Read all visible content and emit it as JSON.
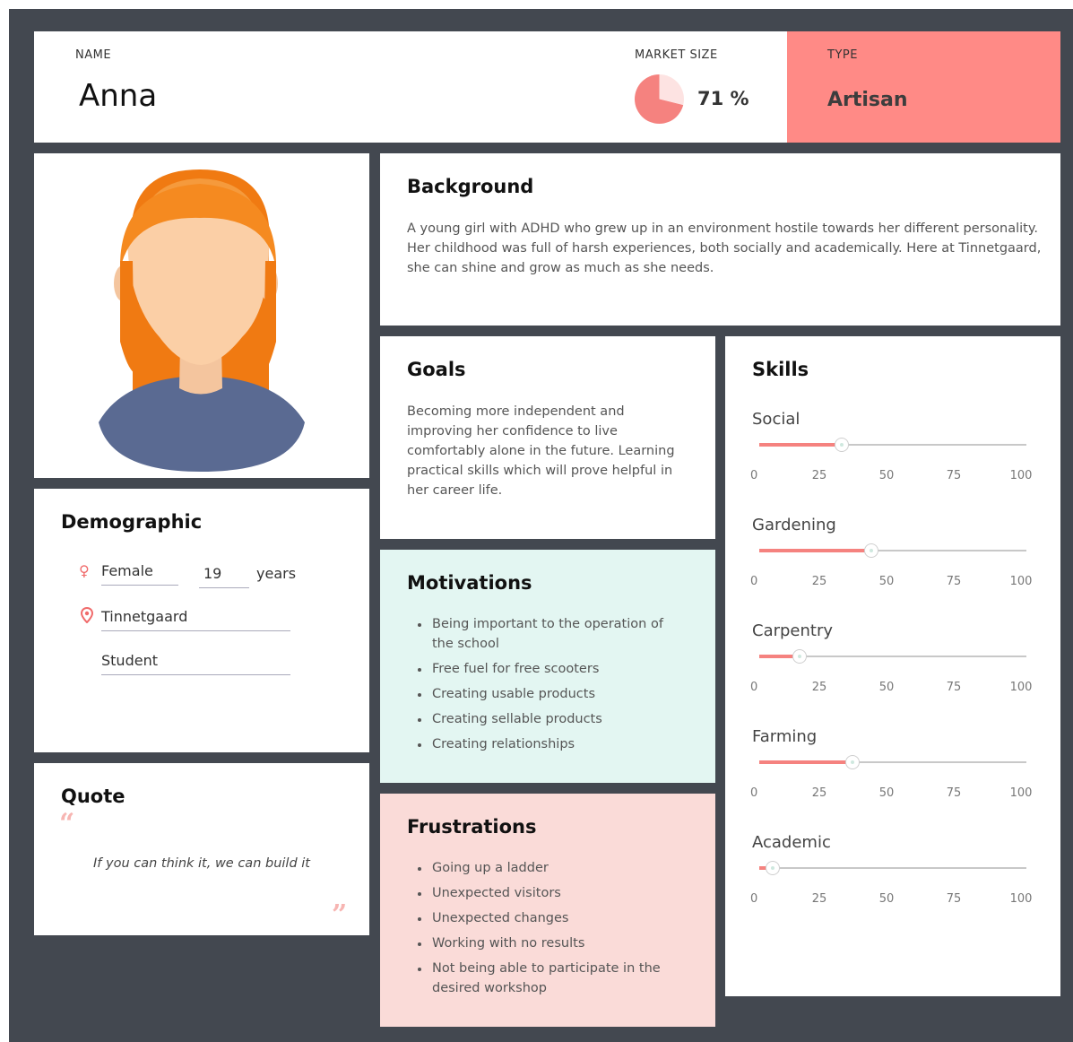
{
  "header": {
    "name_label": "NAME",
    "name": "Anna",
    "market_label": "MARKET SIZE",
    "market_value": "71 %",
    "market_fraction": 0.71,
    "type_label": "TYPE",
    "type": "Artisan"
  },
  "colors": {
    "accent": "#ff8a86",
    "background": "#434850",
    "motivations_bg": "#e3f6f2",
    "frustrations_bg": "#fadbd8",
    "slider_fill": "#f5827f"
  },
  "background": {
    "title": "Background",
    "text": "A young girl with ADHD who grew up in an environment hostile towards her different personality. Her childhood was full of harsh experiences, both socially and academically. Here at Tinnetgaard, she can shine and grow as much as she needs."
  },
  "goals": {
    "title": "Goals",
    "text": "Becoming more independent and improving her confidence to live comfortably alone in the future. Learning practical skills which will prove helpful in her career life."
  },
  "demographic": {
    "title": "Demographic",
    "gender_icon": "female-icon",
    "gender": "Female",
    "age": "19",
    "age_unit": "years",
    "location_icon": "location-pin-icon",
    "location": "Tinnetgaard",
    "occupation": "Student"
  },
  "motivations": {
    "title": "Motivations",
    "items": [
      "Being important to the operation of the school",
      "Free fuel for free scooters",
      "Creating usable products",
      "Creating sellable products",
      "Creating relationships"
    ]
  },
  "frustrations": {
    "title": "Frustrations",
    "items": [
      "Going up a ladder",
      "Unexpected visitors",
      "Unexpected changes",
      "Working with no results",
      "Not being able to participate in the desired workshop"
    ]
  },
  "quote": {
    "title": "Quote",
    "open_mark": "“",
    "close_mark": "”",
    "text": "If you can think it, we can build it"
  },
  "skills": {
    "title": "Skills",
    "ticks": [
      "0",
      "25",
      "50",
      "75",
      "100"
    ],
    "items": [
      {
        "label": "Social",
        "value": 31
      },
      {
        "label": "Gardening",
        "value": 42
      },
      {
        "label": "Carpentry",
        "value": 15
      },
      {
        "label": "Farming",
        "value": 35
      },
      {
        "label": "Academic",
        "value": 5
      }
    ]
  }
}
